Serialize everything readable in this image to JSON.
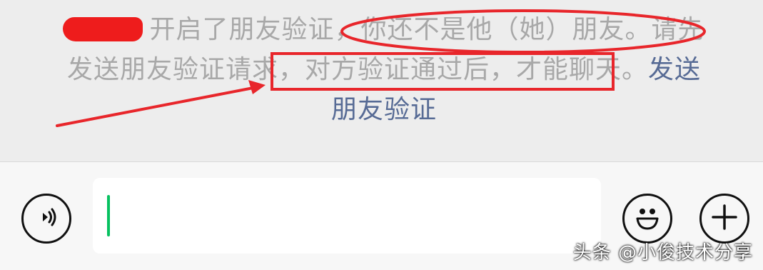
{
  "system_message": {
    "hidden_name": "",
    "part1": "开启了朋友验证，",
    "part2": "你还不是他（她）朋友。",
    "part3": "请先发送朋友验证请求，",
    "part4": "对方验证通过后，才能聊天。",
    "link": "发送朋友验证"
  },
  "colors": {
    "system_text": "#a8a8a8",
    "link": "#576b95",
    "annotation_red": "#e8262b",
    "caret": "#07c160"
  },
  "input_bar": {
    "voice_icon": "voice-wave-icon",
    "input_value": "",
    "emoji_icon": "smiley-face-icon",
    "plus_icon": "plus-icon"
  },
  "watermark": "头条 @小俊技术分享"
}
